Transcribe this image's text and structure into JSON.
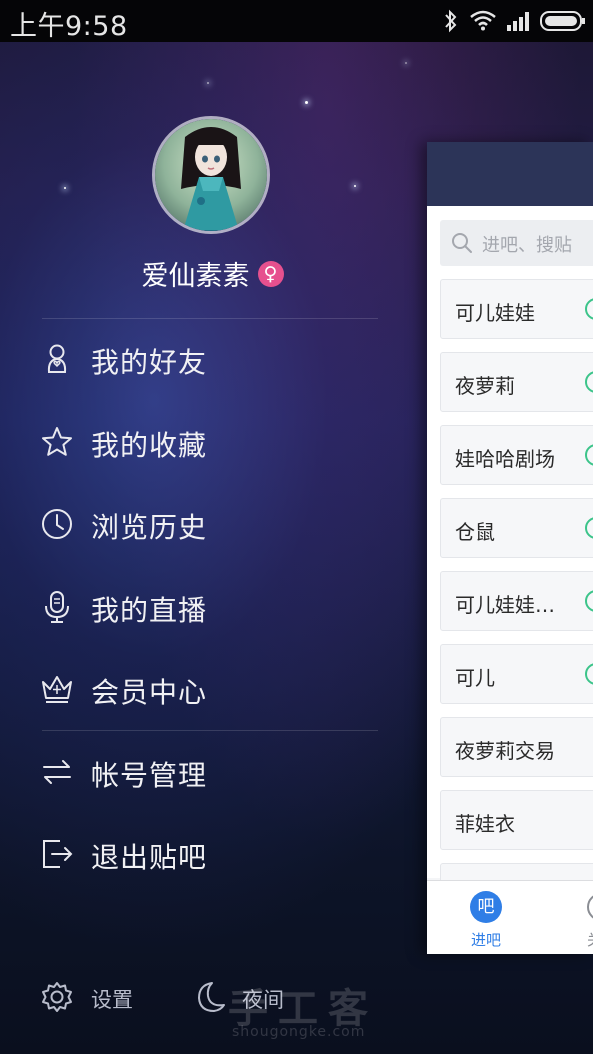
{
  "status_bar": {
    "time": "上午9:58",
    "icons": [
      "bluetooth-icon",
      "wifi-icon",
      "signal-icon",
      "battery-icon"
    ]
  },
  "profile": {
    "username": "爱仙素素",
    "gender_symbol": "♀",
    "gender_color": "#e6508e",
    "avatar": "avatar-photo-doll"
  },
  "menu": {
    "items": [
      {
        "label": "我的好友",
        "icon": "friends-icon"
      },
      {
        "label": "我的收藏",
        "icon": "star-icon"
      },
      {
        "label": "浏览历史",
        "icon": "clock-icon"
      },
      {
        "label": "我的直播",
        "icon": "microphone-icon"
      },
      {
        "label": "会员中心",
        "icon": "crown-icon"
      },
      {
        "label": "帐号管理",
        "icon": "swap-arrows-icon"
      },
      {
        "label": "退出贴吧",
        "icon": "exit-icon"
      }
    ]
  },
  "bottom_bar": {
    "settings_label": "设置",
    "night_label": "夜间"
  },
  "watermark": {
    "text": "手工客",
    "url": "shougongke.com"
  },
  "main_panel": {
    "search_placeholder": "进吧、搜贴",
    "forums": [
      {
        "name": "可儿娃娃",
        "badge": true
      },
      {
        "name": "夜萝莉",
        "badge": true
      },
      {
        "name": "娃哈哈剧场",
        "badge": true
      },
      {
        "name": "仓鼠",
        "badge": true
      },
      {
        "name": "可儿娃娃…",
        "badge": true
      },
      {
        "name": "可儿",
        "badge": true
      },
      {
        "name": "夜萝莉交易",
        "badge": false
      },
      {
        "name": "菲娃衣",
        "badge": false
      },
      {
        "name": "",
        "badge": false
      }
    ],
    "tabs": {
      "enter_icon_text": "吧",
      "enter_label": "进吧",
      "second_label": "关"
    },
    "accent_color": "#2f7ee6",
    "header_color": "#2c3458"
  }
}
